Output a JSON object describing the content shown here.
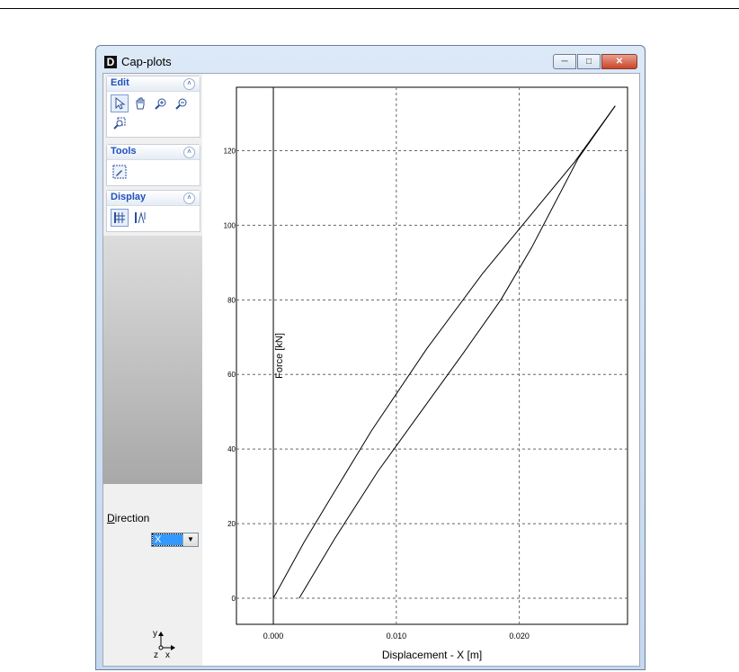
{
  "window": {
    "title": "Cap-plots",
    "icon_letter": "D",
    "buttons": [
      "minimize-icon",
      "maximize-icon",
      "close-icon"
    ]
  },
  "panel": {
    "groups": [
      {
        "title": "Edit",
        "tools": [
          "select-arrow-icon",
          "pan-hand-icon",
          "zoom-in-icon",
          "zoom-out-icon",
          "zoom-extents-icon"
        ]
      },
      {
        "title": "Tools",
        "tools": [
          "measure-icon"
        ]
      },
      {
        "title": "Display",
        "tools": [
          "grid-icon",
          "labels-icon"
        ]
      }
    ],
    "direction": {
      "label": "Direction",
      "underline": "D",
      "rest": "irection",
      "value": "X"
    },
    "triad": {
      "y": "y",
      "z": "z",
      "x": "x"
    }
  },
  "chart_data": {
    "type": "line",
    "xlabel": "Displacement  - X [m]",
    "ylabel": "Force [kN]",
    "xlim": [
      -0.003,
      0.0288
    ],
    "ylim": [
      -7,
      137
    ],
    "xticks": [
      0.0,
      0.01,
      0.02
    ],
    "xtick_labels": [
      "0.000",
      "0.010",
      "0.020"
    ],
    "yticks": [
      0,
      20,
      40,
      60,
      80,
      100,
      120
    ],
    "ytick_labels": [
      "0",
      "20",
      "40",
      "60",
      "80",
      "100",
      "120"
    ],
    "grid": true,
    "series": [
      {
        "x": [
          0.0,
          0.0025,
          0.0045,
          0.008,
          0.0125,
          0.017,
          0.0215,
          0.0245,
          0.0278
        ],
        "y": [
          0,
          15,
          26,
          45,
          67,
          87,
          105,
          117,
          132
        ]
      },
      {
        "x": [
          0.0278,
          0.0248,
          0.021,
          0.0185,
          0.0155,
          0.012,
          0.0085,
          0.005,
          0.0021
        ],
        "y": [
          132,
          118,
          94,
          80,
          66,
          50,
          34,
          16,
          0
        ]
      }
    ],
    "colors": {
      "line": "#000000",
      "grid": "#666666"
    }
  }
}
